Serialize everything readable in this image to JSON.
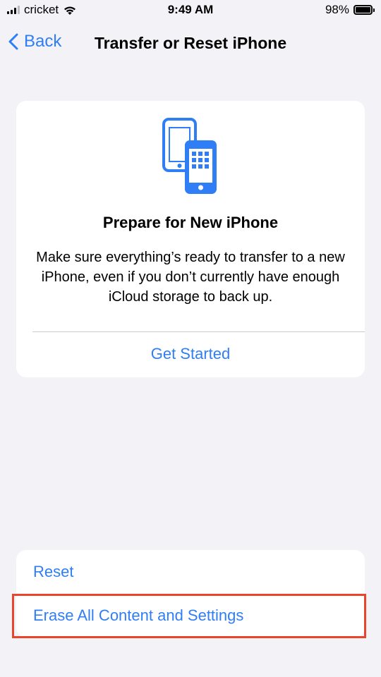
{
  "status_bar": {
    "carrier": "cricket",
    "time": "9:49 AM",
    "battery_percent": "98%",
    "battery_level": 0.98,
    "icons": [
      "signal-icon",
      "wifi-icon",
      "battery-icon"
    ]
  },
  "nav": {
    "back_label": "Back",
    "title": "Transfer or Reset iPhone"
  },
  "prepare_card": {
    "icon": "two-phones-icon",
    "title": "Prepare for New iPhone",
    "description": "Make sure everything’s ready to transfer to a new iPhone, even if you don’t currently have enough iCloud storage to back up.",
    "action_label": "Get Started"
  },
  "reset_section": {
    "items": [
      {
        "label": "Reset"
      },
      {
        "label": "Erase All Content and Settings"
      }
    ]
  },
  "colors": {
    "accent": "#2f7ef6",
    "background": "#f2f2f7",
    "card": "#ffffff",
    "highlight": "#e8452c"
  }
}
